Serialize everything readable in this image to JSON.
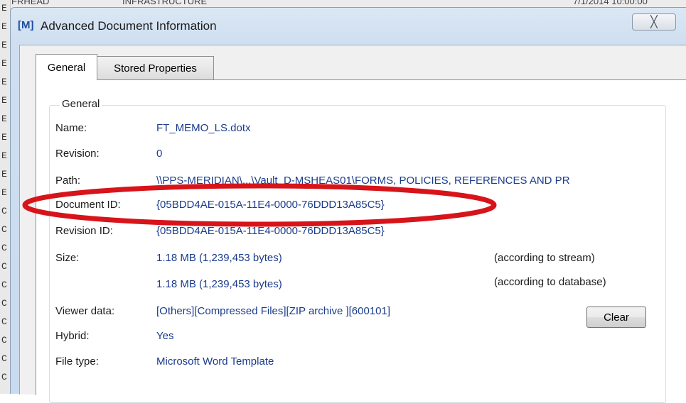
{
  "background": {
    "top_row": [
      "FRHEAD",
      "INFRASTRUCTURE",
      "7/1/2014 10:00:00"
    ],
    "left_strip": [
      "E",
      "E",
      "E",
      "E",
      "E",
      "E",
      "E",
      "E",
      "E",
      "E",
      "E",
      "C",
      "C",
      "C",
      "C",
      "C",
      "C",
      "C",
      "C",
      "C",
      "C"
    ]
  },
  "dialog": {
    "app_icon": "[M]",
    "title": "Advanced Document Information",
    "close_glyph": "╳",
    "close_icon": "close-icon"
  },
  "tabs": [
    {
      "label": "General",
      "active": true
    },
    {
      "label": "Stored Properties",
      "active": false
    }
  ],
  "general": {
    "group_label": "General",
    "fields": {
      "name": {
        "label": "Name:",
        "value": "FT_MEMO_LS.dotx"
      },
      "revision": {
        "label": "Revision:",
        "value": "0"
      },
      "path": {
        "label": "Path:",
        "value": "\\\\PPS-MERIDIAN\\...\\Vault_D-MSHEAS01\\FORMS, POLICIES, REFERENCES AND PR"
      },
      "document_id": {
        "label": "Document ID:",
        "value": "{05BDD4AE-015A-11E4-0000-76DDD13A85C5}"
      },
      "revision_id": {
        "label": "Revision ID:",
        "value": "{05BDD4AE-015A-11E4-0000-76DDD13A85C5}"
      },
      "size": {
        "label": "Size:",
        "stream_value": "1.18 MB (1,239,453 bytes)",
        "stream_note": "(according to stream)",
        "database_value": "1.18 MB (1,239,453 bytes)",
        "database_note": "(according to database)"
      },
      "viewer_data": {
        "label": "Viewer data:",
        "value": "[Others][Compressed Files][ZIP archive ][600101]"
      },
      "hybrid": {
        "label": "Hybrid:",
        "value": "Yes"
      },
      "file_type": {
        "label": "File type:",
        "value": "Microsoft Word Template"
      }
    },
    "clear_label": "Clear"
  },
  "colors": {
    "value_text": "#1a3c8c",
    "highlight": "#d7141a",
    "title_bar": "#cfdff0"
  }
}
